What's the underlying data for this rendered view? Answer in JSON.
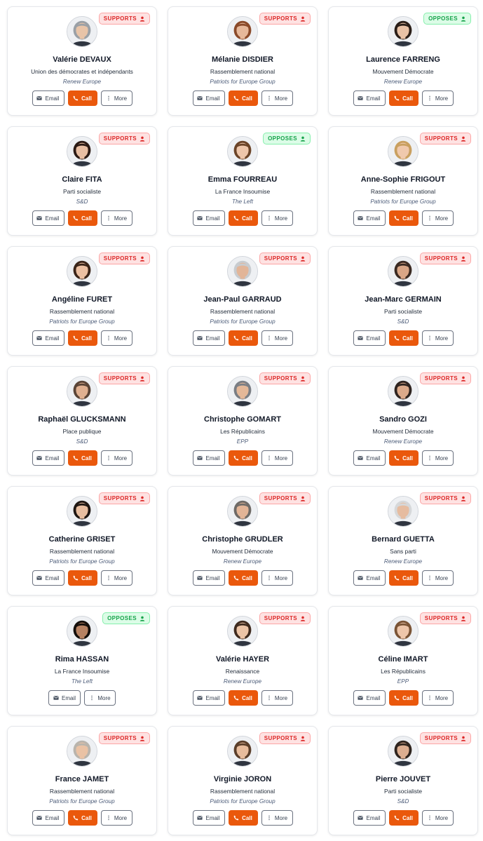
{
  "labels": {
    "email": "Email",
    "call": "Call",
    "more": "More",
    "supports": "SUPPORTS",
    "opposes": "OPPOSES"
  },
  "colors": {
    "accent": "#ea580c",
    "supports": "#dc2626",
    "opposes": "#16a34a"
  },
  "members": [
    {
      "name": "Valérie DEVAUX",
      "party": "Union des démocrates et indépendants",
      "group": "Renew Europe",
      "stance": "supports",
      "has_call": true,
      "skin": "#e8c4a8",
      "hair": "#9aa0a6"
    },
    {
      "name": "Mélanie DISDIER",
      "party": "Rassemblement national",
      "group": "Patriots for Europe Group",
      "stance": "supports",
      "has_call": true,
      "skin": "#e6b89a",
      "hair": "#8a4a2a"
    },
    {
      "name": "Laurence FARRENG",
      "party": "Mouvement Démocrate",
      "group": "Renew Europe",
      "stance": "opposes",
      "has_call": true,
      "skin": "#e9c2a6",
      "hair": "#2a1e18"
    },
    {
      "name": "Claire FITA",
      "party": "Parti socialiste",
      "group": "S&D",
      "stance": "supports",
      "has_call": true,
      "skin": "#e8bea2",
      "hair": "#2b1a14"
    },
    {
      "name": "Emma FOURREAU",
      "party": "La France Insoumise",
      "group": "The Left",
      "stance": "opposes",
      "has_call": true,
      "skin": "#eec6aa",
      "hair": "#6b4428"
    },
    {
      "name": "Anne-Sophie FRIGOUT",
      "party": "Rassemblement national",
      "group": "Patriots for Europe Group",
      "stance": "supports",
      "has_call": true,
      "skin": "#f0c9ad",
      "hair": "#c9a060"
    },
    {
      "name": "Angéline FURET",
      "party": "Rassemblement national",
      "group": "Patriots for Europe Group",
      "stance": "supports",
      "has_call": true,
      "skin": "#ecc0a2",
      "hair": "#3a2418"
    },
    {
      "name": "Jean-Paul GARRAUD",
      "party": "Rassemblement national",
      "group": "Patriots for Europe Group",
      "stance": "supports",
      "has_call": true,
      "skin": "#e2b598",
      "hair": "#c8ccd0"
    },
    {
      "name": "Jean-Marc GERMAIN",
      "party": "Parti socialiste",
      "group": "S&D",
      "stance": "supports",
      "has_call": true,
      "skin": "#d9a686",
      "hair": "#3a2a22"
    },
    {
      "name": "Raphaël GLUCKSMANN",
      "party": "Place publique",
      "group": "S&D",
      "stance": "supports",
      "has_call": true,
      "skin": "#e0b090",
      "hair": "#5a4436"
    },
    {
      "name": "Christophe GOMART",
      "party": "Les Républicains",
      "group": "EPP",
      "stance": "supports",
      "has_call": true,
      "skin": "#e4b898",
      "hair": "#7a7e84"
    },
    {
      "name": "Sandro GOZI",
      "party": "Mouvement Démocrate",
      "group": "Renew Europe",
      "stance": "supports",
      "has_call": true,
      "skin": "#dcaa8a",
      "hair": "#2e2420"
    },
    {
      "name": "Catherine GRISET",
      "party": "Rassemblement national",
      "group": "Patriots for Europe Group",
      "stance": "supports",
      "has_call": true,
      "skin": "#e8bea0",
      "hair": "#1e1612"
    },
    {
      "name": "Christophe GRUDLER",
      "party": "Mouvement Démocrate",
      "group": "Renew Europe",
      "stance": "supports",
      "has_call": true,
      "skin": "#e2b496",
      "hair": "#6e6a66"
    },
    {
      "name": "Bernard GUETTA",
      "party": "Sans parti",
      "group": "Renew Europe",
      "stance": "supports",
      "has_call": true,
      "skin": "#e6bca0",
      "hair": "#d6d8da"
    },
    {
      "name": "Rima HASSAN",
      "party": "La France Insoumise",
      "group": "The Left",
      "stance": "opposes",
      "has_call": false,
      "skin": "#b78262",
      "hair": "#140e0a"
    },
    {
      "name": "Valérie HAYER",
      "party": "Renaissance",
      "group": "Renew Europe",
      "stance": "supports",
      "has_call": true,
      "skin": "#ecc4a6",
      "hair": "#3e2a1e"
    },
    {
      "name": "Céline IMART",
      "party": "Les Républicains",
      "group": "EPP",
      "stance": "supports",
      "has_call": true,
      "skin": "#eec6aa",
      "hair": "#7a5436"
    },
    {
      "name": "France JAMET",
      "party": "Rassemblement national",
      "group": "Patriots for Europe Group",
      "stance": "supports",
      "has_call": true,
      "skin": "#eac2a4",
      "hair": "#b9b4ac"
    },
    {
      "name": "Virginie JORON",
      "party": "Rassemblement national",
      "group": "Patriots for Europe Group",
      "stance": "supports",
      "has_call": true,
      "skin": "#e8bc9c",
      "hair": "#5a3e2a"
    },
    {
      "name": "Pierre JOUVET",
      "party": "Parti socialiste",
      "group": "S&D",
      "stance": "supports",
      "has_call": true,
      "skin": "#dcae90",
      "hair": "#2e241e"
    }
  ]
}
